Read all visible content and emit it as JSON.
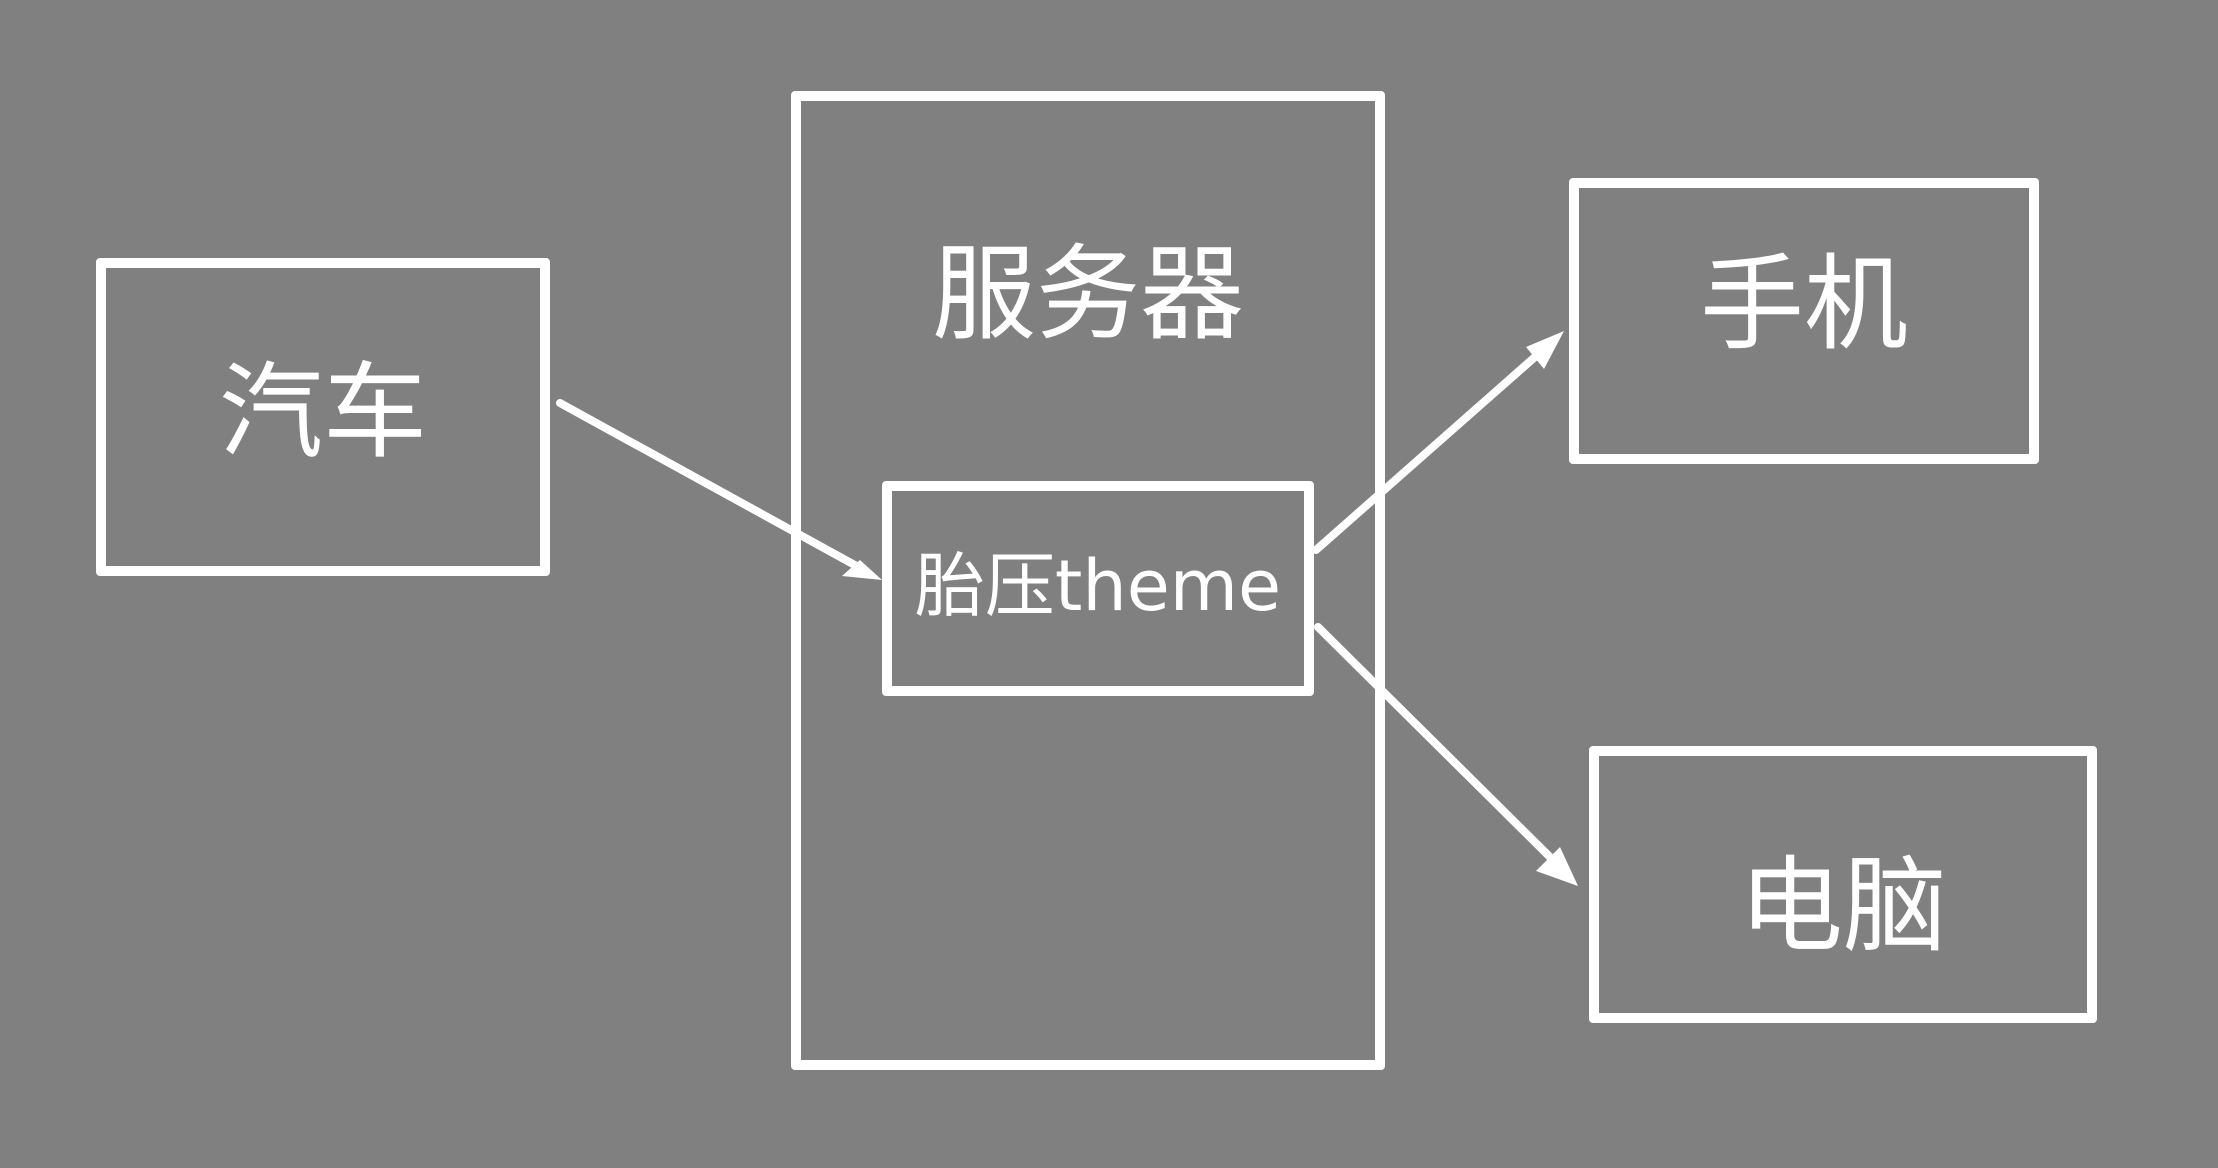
{
  "colors": {
    "background": "#808080",
    "stroke": "#ffffff",
    "text": "#ffffff"
  },
  "nodes": {
    "car": {
      "label": "汽车"
    },
    "server": {
      "label": "服务器"
    },
    "tire_pressure": {
      "label": "胎压theme"
    },
    "phone": {
      "label": "手机"
    },
    "computer": {
      "label": "电脑"
    }
  },
  "edges": [
    {
      "from": "car",
      "to": "tire_pressure"
    },
    {
      "from": "tire_pressure",
      "to": "phone"
    },
    {
      "from": "tire_pressure",
      "to": "computer"
    }
  ]
}
